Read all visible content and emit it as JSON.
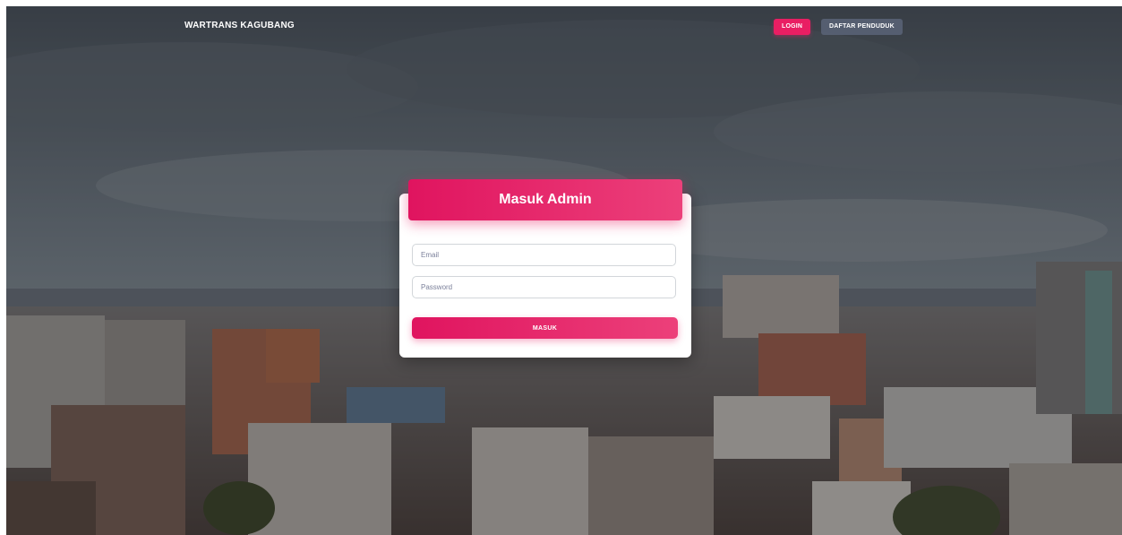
{
  "navbar": {
    "brand": "WARTRANS KAGUBANG",
    "login_label": "LOGIN",
    "daftar_label": "DAFTAR PENDUDUK"
  },
  "login_card": {
    "title": "Masuk Admin",
    "email_placeholder": "Email",
    "password_placeholder": "Password",
    "submit_label": "MASUK"
  },
  "colors": {
    "accent": "#e91e63",
    "secondary_button": "#5a6478",
    "card": "#ffffff"
  },
  "background": {
    "description_icon": "city-skyline-photo"
  }
}
